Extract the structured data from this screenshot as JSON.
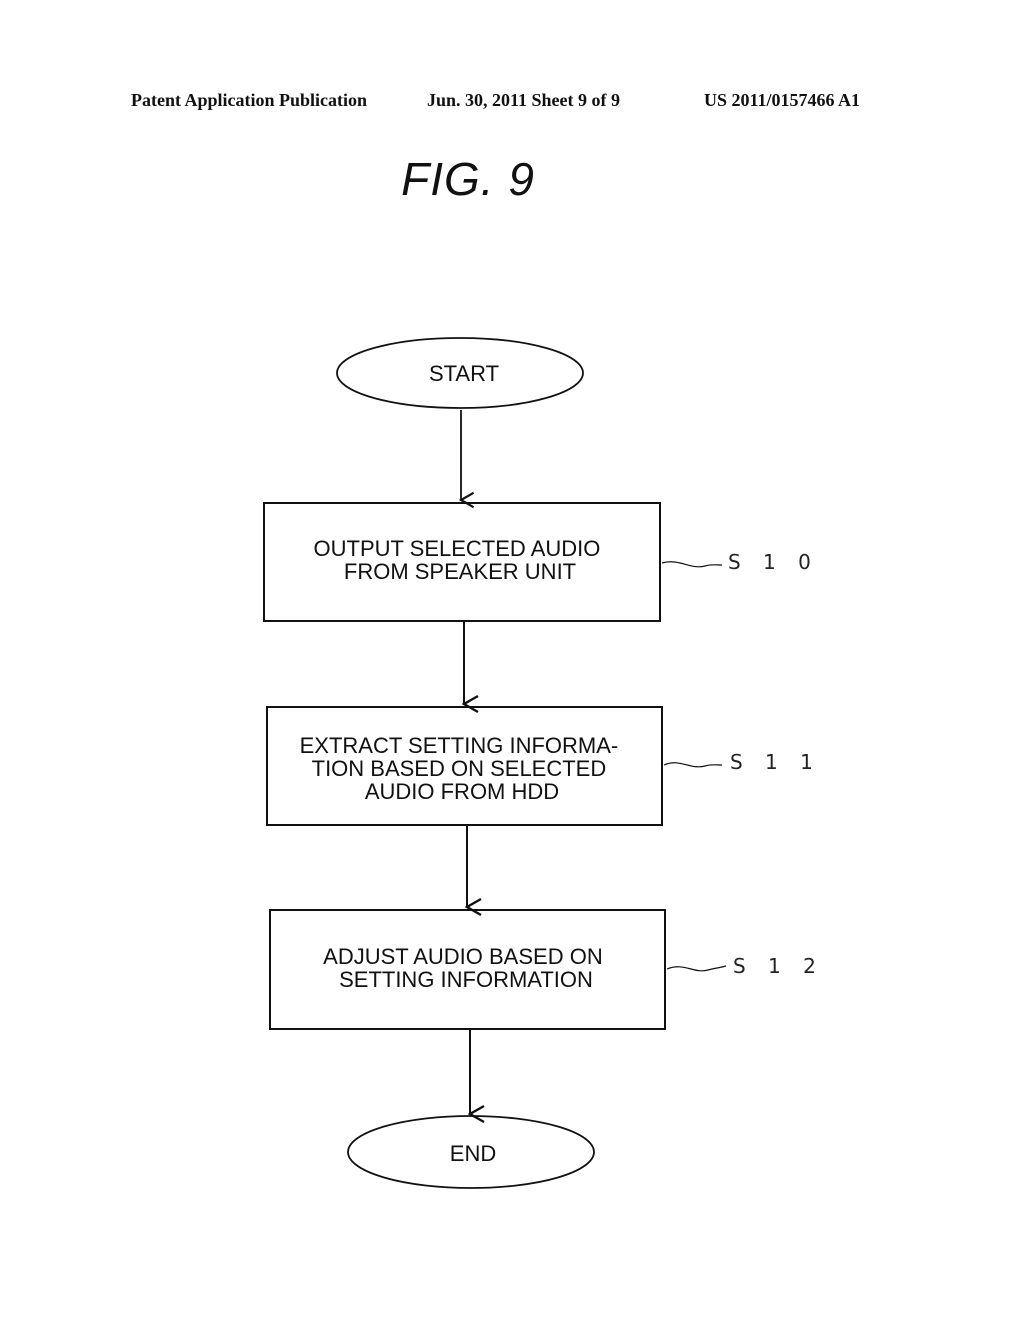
{
  "header": {
    "publication": "Patent Application Publication",
    "date_sheet": "Jun. 30, 2011   Sheet 9 of 9",
    "number": "US 2011/0157466 A1"
  },
  "figure_title": "FIG. 9",
  "flowchart": {
    "start": "START",
    "end": "END",
    "steps": [
      {
        "id": "S10",
        "label_ref": "S 1 0",
        "lines": [
          "OUTPUT SELECTED AUDIO",
          "FROM SPEAKER UNIT"
        ]
      },
      {
        "id": "S11",
        "label_ref": "S 1 1",
        "lines": [
          "EXTRACT SETTING INFORMA-",
          "TION BASED ON SELECTED",
          "AUDIO FROM HDD"
        ]
      },
      {
        "id": "S12",
        "label_ref": "S 1 2",
        "lines": [
          "ADJUST AUDIO BASED ON",
          "SETTING INFORMATION"
        ]
      }
    ]
  }
}
